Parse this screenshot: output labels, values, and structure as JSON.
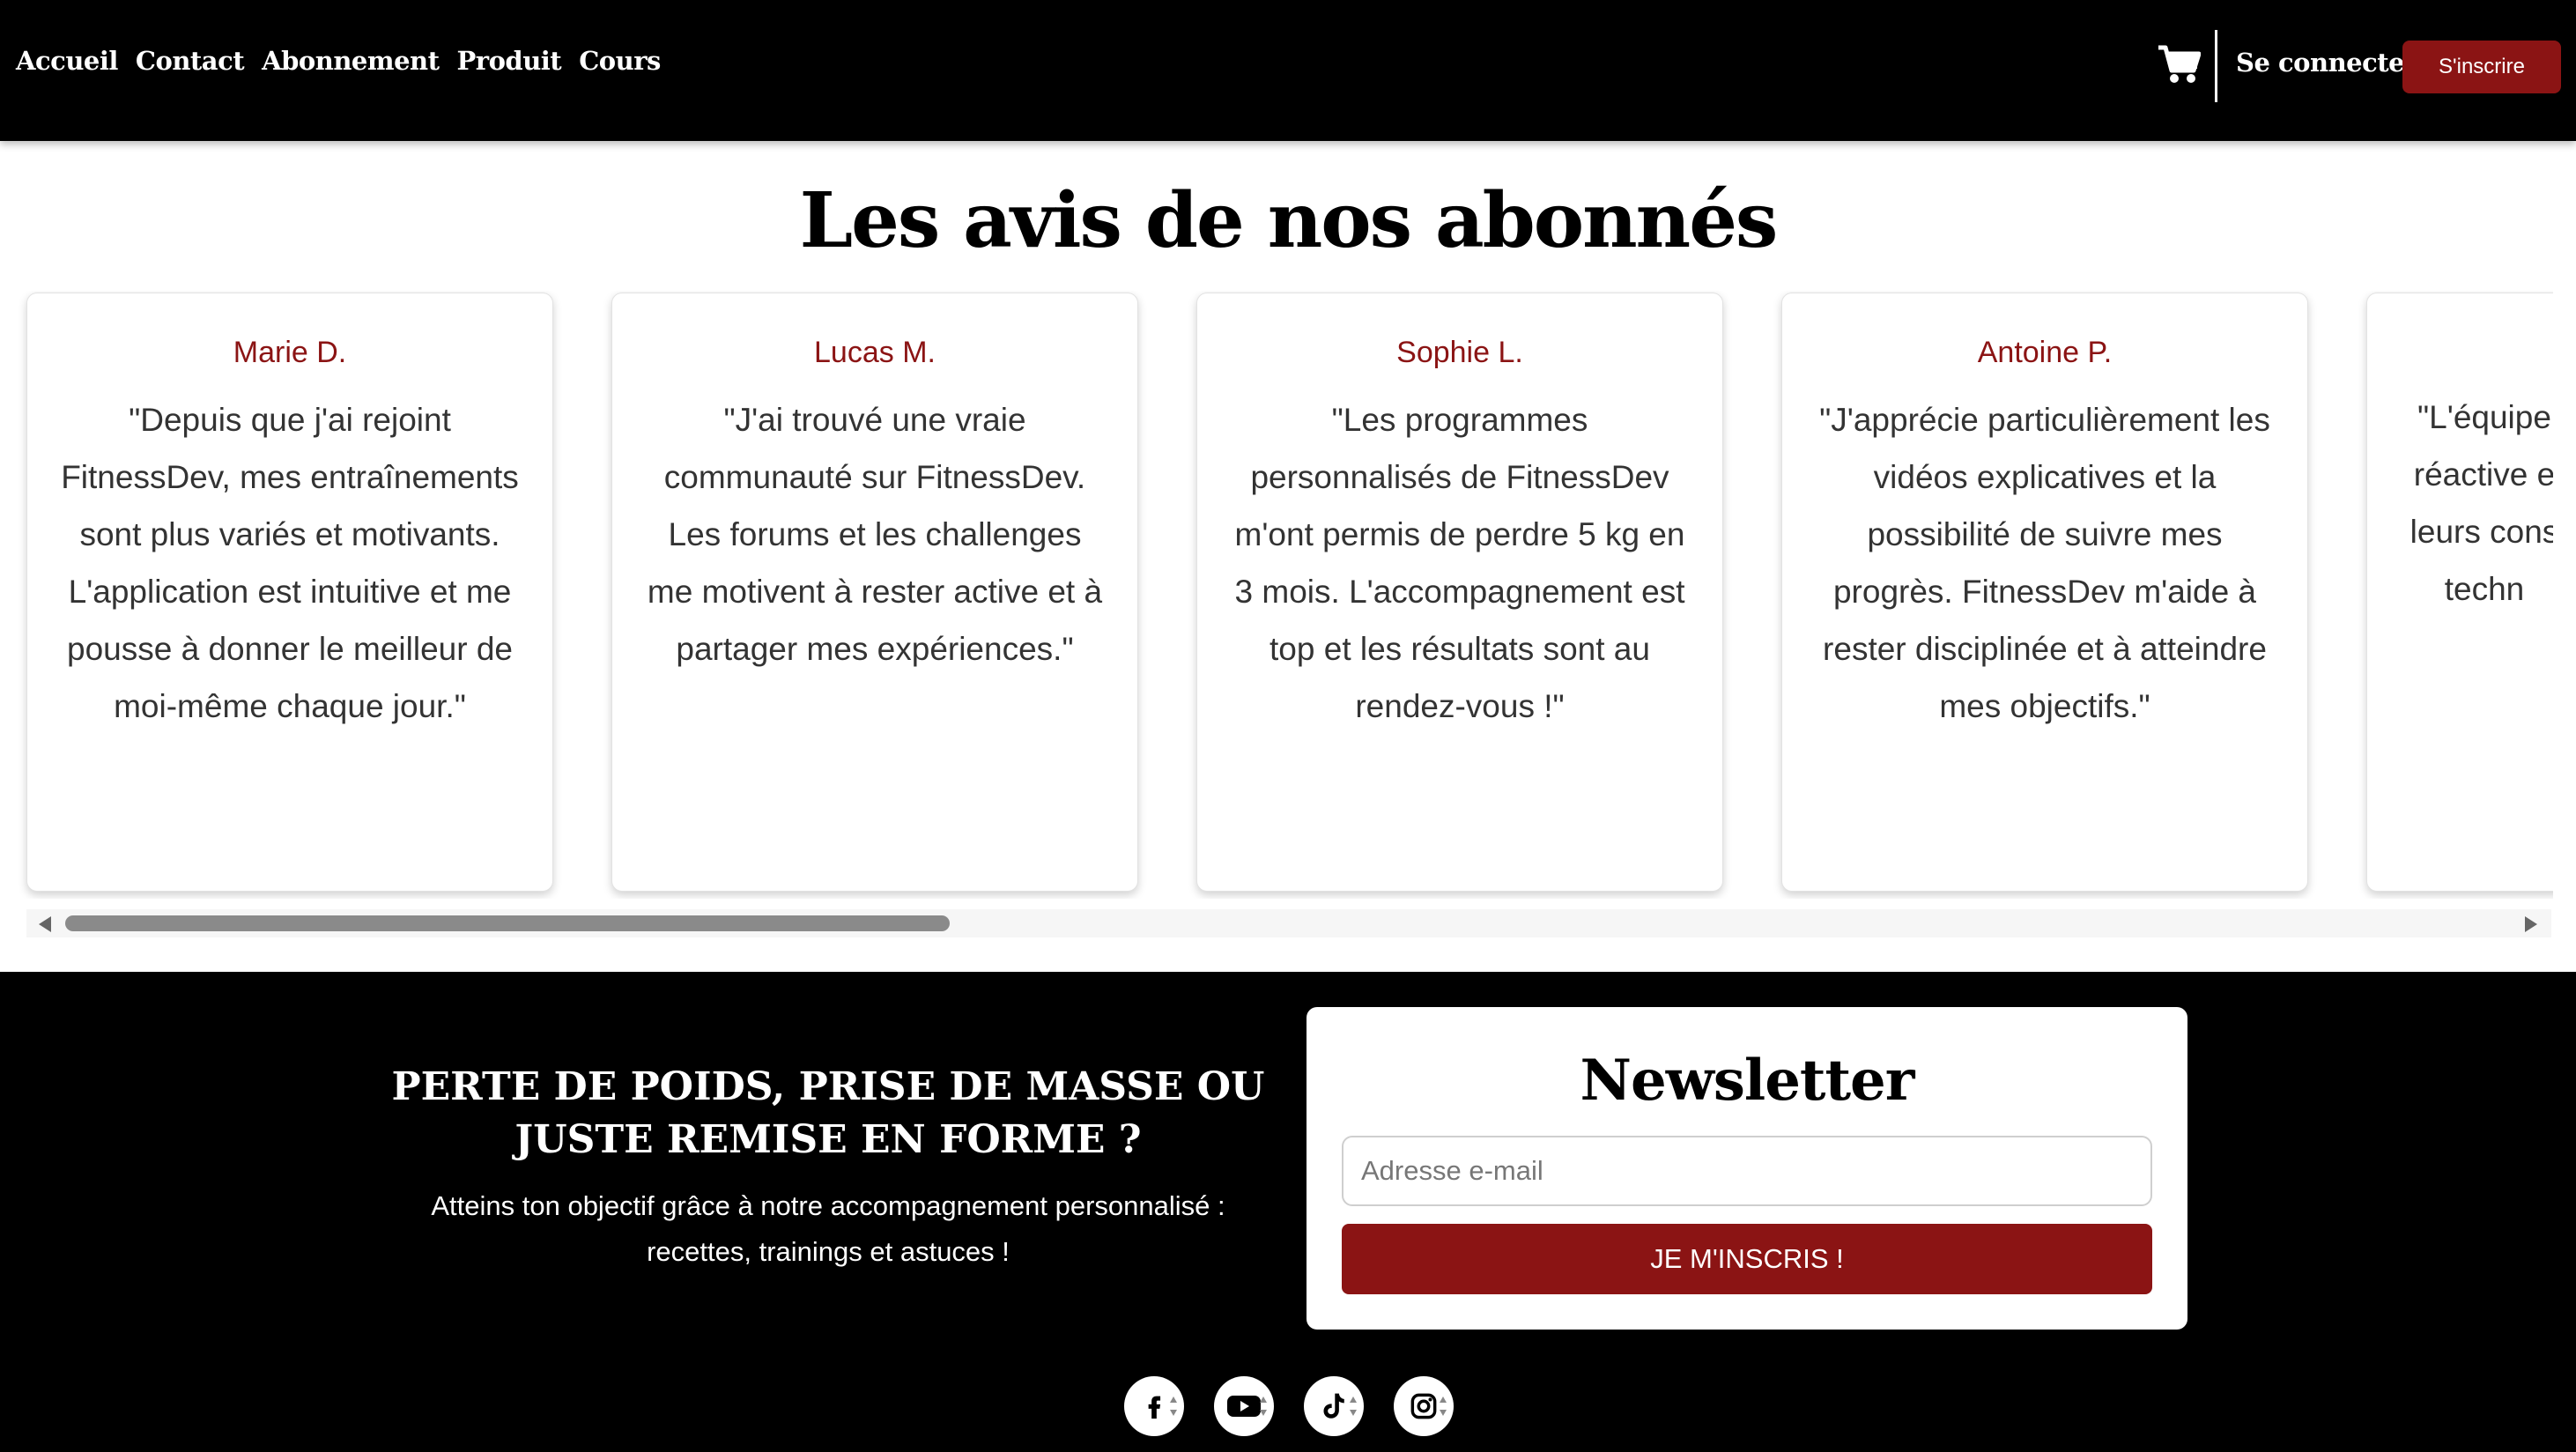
{
  "header": {
    "nav": [
      "Accueil",
      "Contact",
      "Abonnement",
      "Produit",
      "Cours"
    ],
    "cart_icon": "shopping-cart-icon",
    "login_label": "Se connecter",
    "signup_label": "S'inscrire"
  },
  "reviews": {
    "title": "Les avis de nos abonnés",
    "items": [
      {
        "name": "Marie D.",
        "text": "\"Depuis que j'ai rejoint FitnessDev, mes entraînements sont plus variés et motivants. L'application est intuitive et me pousse à donner le meilleur de moi-même chaque jour.\""
      },
      {
        "name": "Lucas M.",
        "text": "\"J'ai trouvé une vraie communauté sur FitnessDev. Les forums et les challenges me motivent à rester active et à partager mes expériences.\""
      },
      {
        "name": "Sophie L.",
        "text": "\"Les programmes personnalisés de FitnessDev m'ont permis de perdre 5 kg en 3 mois. L'accompagnement est top et les résultats sont au rendez-vous !\""
      },
      {
        "name": "Antoine P.",
        "text": "\"J'apprécie particulièrement les vidéos explicatives et la possibilité de suivre mes progrès. FitnessDev m'aide à rester disciplinée et à atteindre mes objectifs.\""
      },
      {
        "name": "",
        "text": "\"L'équipe réactive e leurs cons techn"
      }
    ]
  },
  "footer": {
    "promo_title": "PERTE DE POIDS, PRISE DE MASSE OU JUSTE REMISE EN FORME ?",
    "promo_text": "Atteins ton objectif grâce à notre accompagnement personnalisé : recettes, trainings et astuces !",
    "newsletter": {
      "title": "Newsletter",
      "email_placeholder": "Adresse e-mail",
      "submit_label": "JE M'INSCRIS !"
    },
    "socials": [
      "facebook-icon",
      "youtube-icon",
      "tiktok-icon",
      "instagram-icon"
    ]
  },
  "colors": {
    "accent": "#8b1414",
    "header_bg": "#000000",
    "footer_bg": "#000000"
  }
}
